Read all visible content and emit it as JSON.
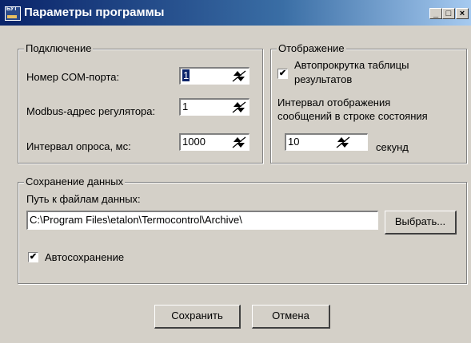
{
  "window": {
    "title": "Параметры программы",
    "icon_text": "БУТ"
  },
  "title_controls": {
    "minimize": "_",
    "maximize": "□",
    "close": "×"
  },
  "connection": {
    "legend": "Подключение",
    "com_port_label": "Номер COM-порта:",
    "com_port_value": "1",
    "modbus_label": "Modbus-адрес регулятора:",
    "modbus_value": "1",
    "poll_label": "Интервал опроса, мс:",
    "poll_value": "1000"
  },
  "display": {
    "legend": "Отображение",
    "autoscroll_label_1": "Автопрокрутка таблицы",
    "autoscroll_label_2": "результатов",
    "autoscroll_checked": "✔",
    "interval_label_1": "Интервал отображения",
    "interval_label_2": "сообщений в строке состояния",
    "interval_value": "10",
    "interval_unit": "секунд"
  },
  "saving": {
    "legend": "Сохранение данных",
    "path_label": "Путь к файлам данных:",
    "path_value": "C:\\Program Files\\etalon\\Termocontrol\\Archive\\",
    "browse_button": "Выбрать...",
    "autosave_label": "Автосохранение",
    "autosave_checked": "✔"
  },
  "footer": {
    "save_button": "Сохранить",
    "cancel_button": "Отмена"
  }
}
